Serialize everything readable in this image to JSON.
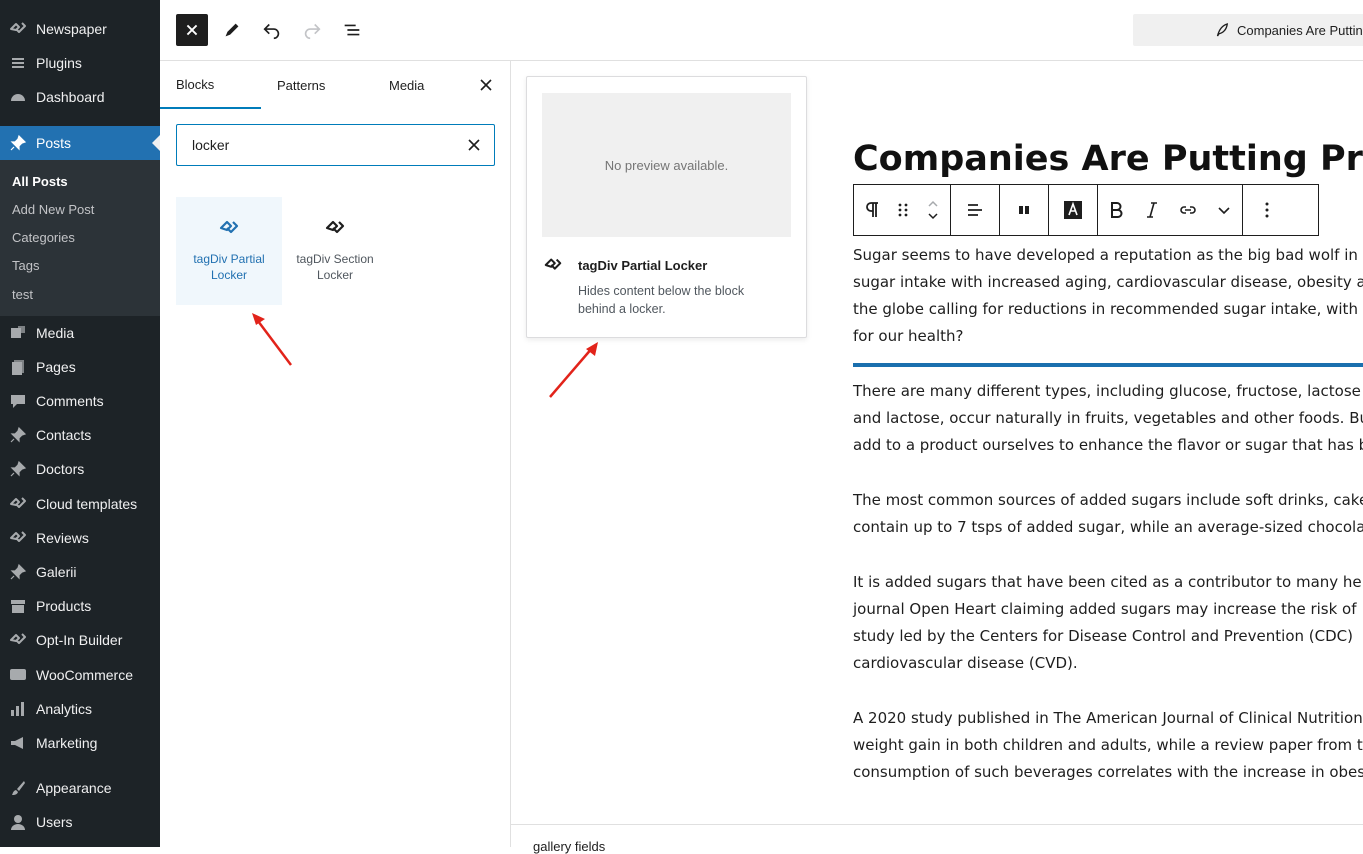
{
  "admin_menu": [
    {
      "label": "Newspaper",
      "icon": "tagdiv-icon"
    },
    {
      "label": "Plugins",
      "icon": "plugins-icon"
    },
    {
      "label": "Dashboard",
      "icon": "dashboard-icon"
    },
    {
      "label": "Posts",
      "icon": "pin-icon",
      "active": true
    },
    {
      "label": "Media",
      "icon": "media-icon"
    },
    {
      "label": "Pages",
      "icon": "pages-icon"
    },
    {
      "label": "Comments",
      "icon": "comments-icon"
    },
    {
      "label": "Contacts",
      "icon": "pin-icon"
    },
    {
      "label": "Doctors",
      "icon": "pin-icon"
    },
    {
      "label": "Cloud templates",
      "icon": "tagdiv-icon"
    },
    {
      "label": "Reviews",
      "icon": "tagdiv-icon"
    },
    {
      "label": "Galerii",
      "icon": "pin-icon"
    },
    {
      "label": "Products",
      "icon": "products-icon"
    },
    {
      "label": "Opt-In Builder",
      "icon": "tagdiv-icon"
    },
    {
      "label": "WooCommerce",
      "icon": "woo-icon"
    },
    {
      "label": "Analytics",
      "icon": "analytics-icon"
    },
    {
      "label": "Marketing",
      "icon": "megaphone-icon"
    },
    {
      "label": "Appearance",
      "icon": "brush-icon"
    },
    {
      "label": "Users",
      "icon": "users-icon"
    }
  ],
  "posts_submenu": [
    "All Posts",
    "Add New Post",
    "Categories",
    "Tags",
    "test"
  ],
  "topbar": {
    "document_title": "Companies Are Putting Profits"
  },
  "inserter": {
    "tabs": [
      "Blocks",
      "Patterns",
      "Media"
    ],
    "search_value": "locker",
    "results": [
      {
        "label": "tagDiv Partial Locker",
        "icon": "tagdiv-icon",
        "selected": true
      },
      {
        "label": "tagDiv Section Locker",
        "icon": "tagdiv-icon",
        "selected": false
      }
    ]
  },
  "preview": {
    "placeholder": "No preview available.",
    "title": "tagDiv Partial Locker",
    "description": "Hides content below the block behind a locker."
  },
  "editor": {
    "post_title": "Companies Are Putting Profits",
    "paragraphs": [
      [
        "Sugar seems to have developed a reputation as the big bad wolf in",
        "sugar intake with increased aging, cardiovascular disease, obesity a",
        "the globe calling for reductions in recommended sugar intake, with",
        "for our health?"
      ],
      [
        "There are many different types, including glucose, fructose, lactose",
        "and lactose, occur naturally in fruits, vegetables and other foods. Bu",
        "add to a product ourselves to enhance the flavor or sugar that has b"
      ],
      [
        "The most common sources of added sugars include soft drinks, cake",
        "contain up to 7 tsps of added sugar, while an average-sized chocola"
      ],
      [
        "It is added sugars that have been cited as a contributor to many he",
        "journal Open Heart claiming added sugars may increase the risk of",
        "study led by the Centers for Disease Control and Prevention (CDC)",
        "cardiovascular disease (CVD)."
      ],
      [
        "A 2020 study published in The American Journal of Clinical Nutrition",
        "weight gain in both children and adults, while a review paper from t",
        "consumption of such beverages correlates with the increase in obes"
      ]
    ],
    "meta_label": "gallery fields"
  },
  "colors": {
    "admin_bg": "#1d2327",
    "accent": "#2271b1",
    "arrow": "#e2231a"
  }
}
